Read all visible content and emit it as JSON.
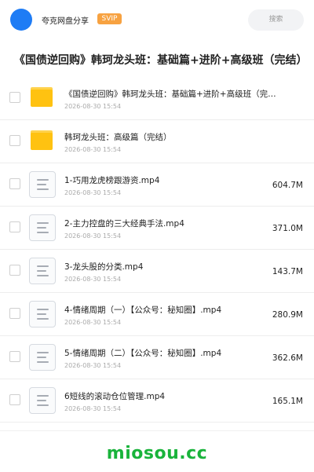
{
  "header": {
    "app_name": "夸克网盘分享",
    "vip_label": "SVIP",
    "search_label": "搜索"
  },
  "title": "《国债逆回购》韩珂龙头班：基础篇+进阶+高级班（完结）",
  "files": [
    {
      "type": "folder",
      "icon": "folder-icon",
      "name": "《国债逆回购》韩珂龙头班：基础篇+进阶+高级班（完…",
      "date": "2026-08-30 15:54",
      "size": ""
    },
    {
      "type": "folder",
      "icon": "folder-icon",
      "name": "韩珂龙头班：高级篇（完结）",
      "date": "2026-08-30 15:54",
      "size": ""
    },
    {
      "type": "video",
      "icon": "document-icon",
      "name": "1-巧用龙虎榜跟游资.mp4",
      "date": "2026-08-30 15:54",
      "size": "604.7M"
    },
    {
      "type": "video",
      "icon": "document-icon",
      "name": "2-主力控盘的三大经典手法.mp4",
      "date": "2026-08-30 15:54",
      "size": "371.0M"
    },
    {
      "type": "video",
      "icon": "document-icon",
      "name": "3-龙头股的分类.mp4",
      "date": "2026-08-30 15:54",
      "size": "143.7M"
    },
    {
      "type": "video",
      "icon": "document-icon",
      "name": "4-情绪周期（一）【公众号：秘知圈】.mp4",
      "date": "2026-08-30 15:54",
      "size": "280.9M"
    },
    {
      "type": "video",
      "icon": "document-icon",
      "name": "5-情绪周期（二）【公众号：秘知圈】.mp4",
      "date": "2026-08-30 15:54",
      "size": "362.6M"
    },
    {
      "type": "video",
      "icon": "document-icon",
      "name": "6短线的滚动仓位管理.mp4",
      "date": "2026-08-30 15:54",
      "size": "165.1M"
    }
  ],
  "watermark": "miosou.cc",
  "colors": {
    "accent": "#1e7cf5",
    "vip": "#f7a241",
    "folder": "#ffc211",
    "watermark": "#19b33b"
  }
}
